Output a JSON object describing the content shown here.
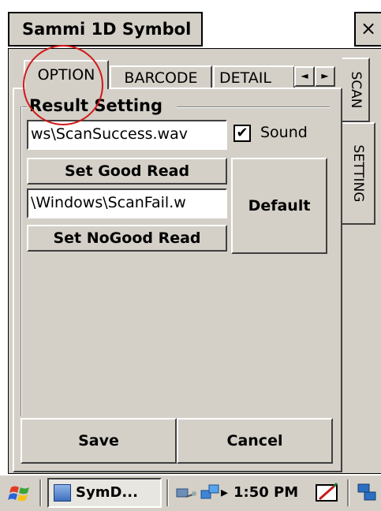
{
  "window": {
    "title": "Sammi 1D Symbol",
    "close_label": "×"
  },
  "tabs": {
    "items": [
      "OPTION",
      "BARCODE",
      "DETAIL"
    ],
    "scroll_left": "◄",
    "scroll_right": "►",
    "side": [
      "SCAN",
      "SETTING"
    ]
  },
  "result_setting": {
    "group_label": "Result Setting",
    "success_file": "ws\\ScanSuccess.wav",
    "sound_label": "Sound",
    "sound_checked": true,
    "set_good_read_label": "Set Good Read",
    "fail_file": "\\Windows\\ScanFail.w",
    "default_label": "Default",
    "set_nogood_read_label": "Set NoGood Read"
  },
  "actions": {
    "save_label": "Save",
    "cancel_label": "Cancel"
  },
  "taskbar": {
    "app_label": "SymD...",
    "time": "1:50 PM",
    "arrow": "▸"
  }
}
